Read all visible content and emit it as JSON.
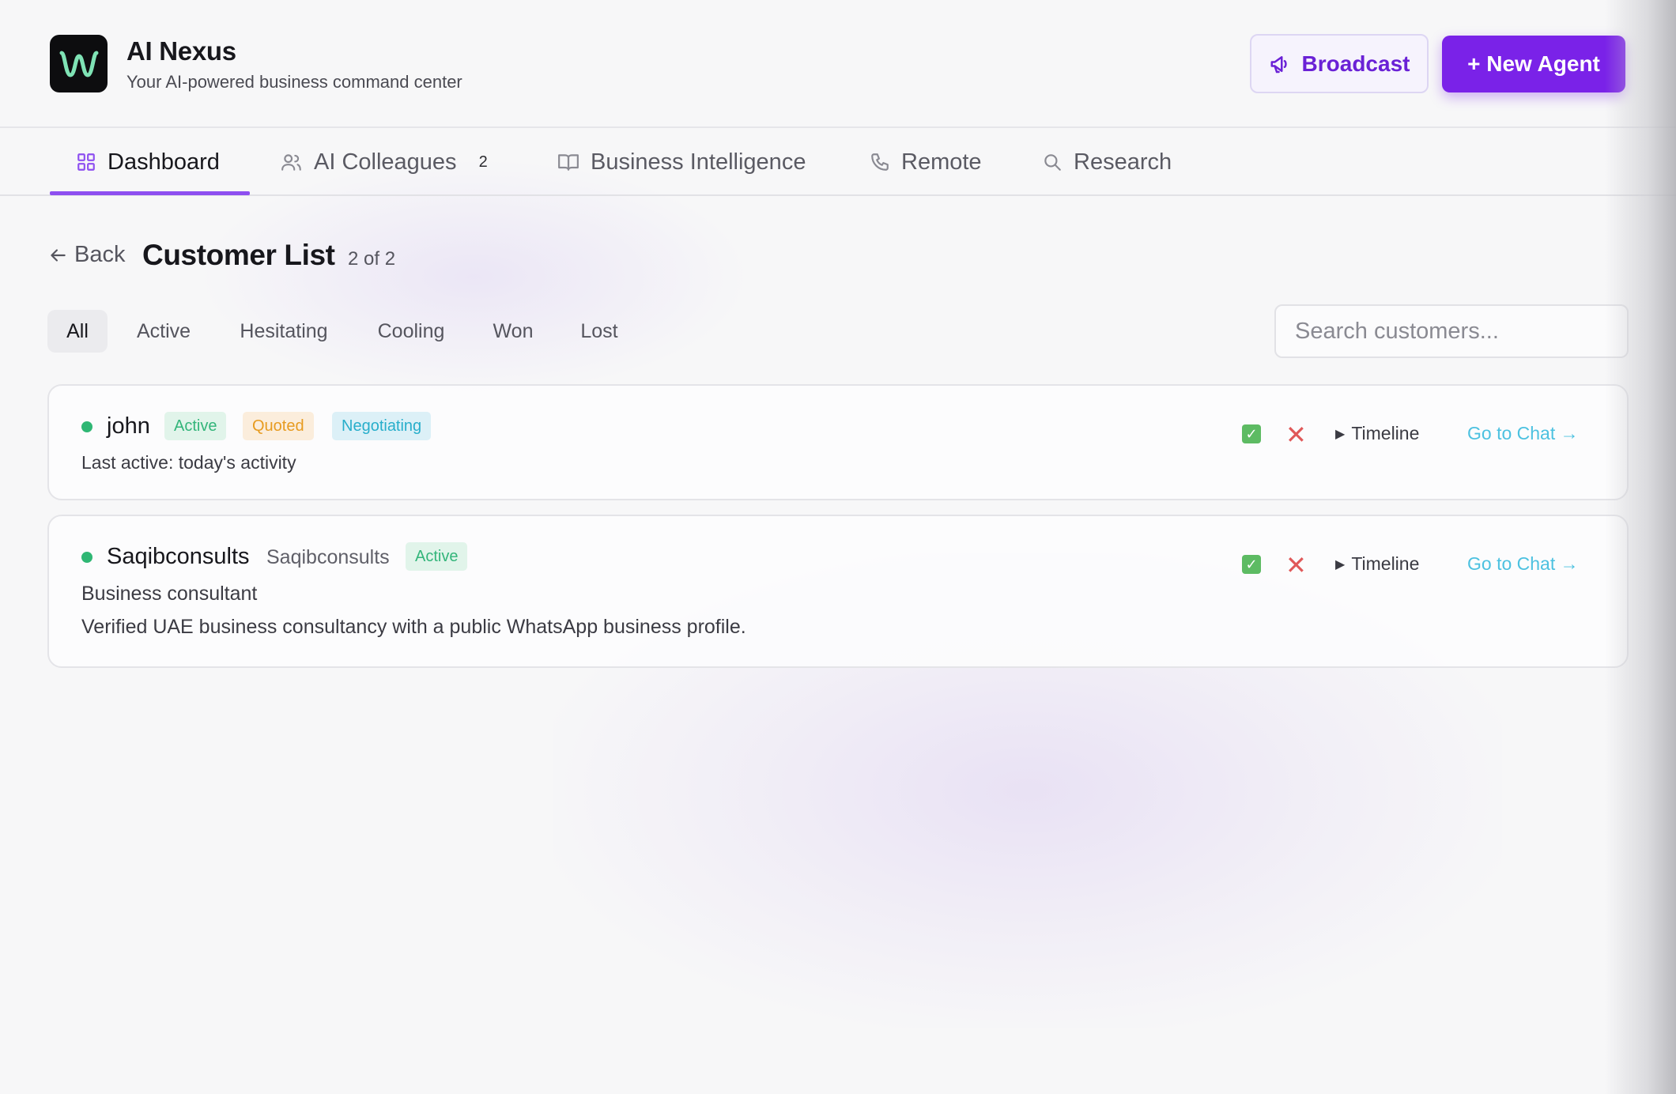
{
  "app": {
    "title": "AI Nexus",
    "subtitle": "Your AI-powered business command center",
    "broadcast_label": "Broadcast",
    "new_agent_label": "+ New Agent"
  },
  "tabs": [
    {
      "label": "Dashboard",
      "icon": "grid-icon",
      "active": true
    },
    {
      "label": "AI Colleagues",
      "icon": "users-icon",
      "badge": "2"
    },
    {
      "label": "Business Intelligence",
      "icon": "book-icon"
    },
    {
      "label": "Remote",
      "icon": "phone-icon"
    },
    {
      "label": "Research",
      "icon": "search-icon"
    }
  ],
  "page": {
    "back_label": "Back",
    "title": "Customer List",
    "count": "2 of 2"
  },
  "filters": [
    "All",
    "Active",
    "Hesitating",
    "Cooling",
    "Won",
    "Lost"
  ],
  "selected_filter": "All",
  "search": {
    "placeholder": "Search customers...",
    "value": ""
  },
  "customers": [
    {
      "name": "john",
      "status_color": "#2fb774",
      "badges": [
        "Active",
        "Quoted",
        "Negotiating"
      ],
      "last_active": "Last active: today's activity",
      "timeline_label": "Timeline",
      "chat_label": "Go to Chat →"
    },
    {
      "name": "Saqibconsults",
      "alias": "Saqibconsults",
      "status_color": "#2fb774",
      "badges": [
        "Active"
      ],
      "role": "Business consultant",
      "description": "Verified UAE business consultancy with a public WhatsApp business profile.",
      "timeline_label": "Timeline",
      "chat_label": "Go to Chat →"
    }
  ],
  "colors": {
    "accent": "#7a22e8",
    "tab_underline": "#8e4ff0",
    "active_badge": "#33b57a",
    "quoted_badge": "#e79b20",
    "negotiating_badge": "#28aecb",
    "chat_link": "#4cc1e0"
  }
}
